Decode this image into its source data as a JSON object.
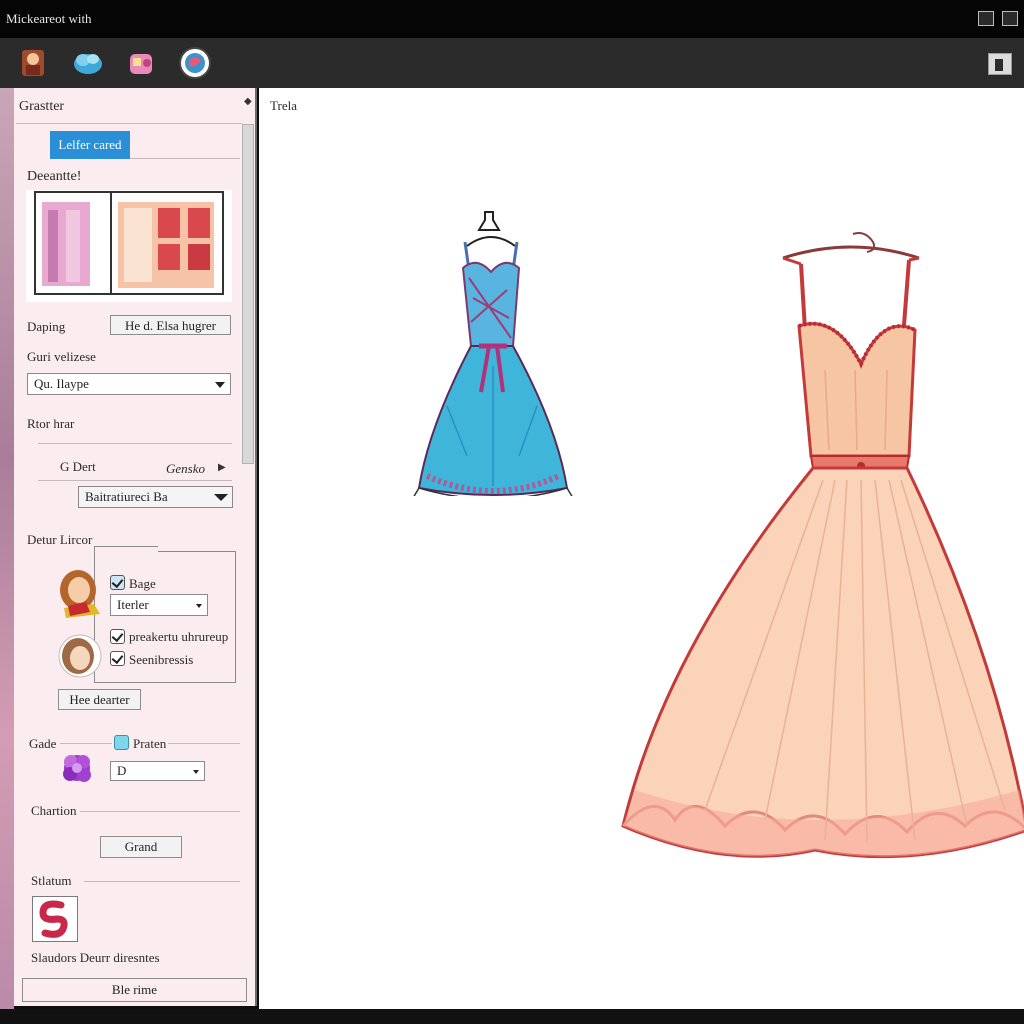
{
  "window": {
    "title": "Mickeareot with"
  },
  "toolbar": {
    "tools": [
      {
        "icon": "character-icon"
      },
      {
        "icon": "cloud-icon"
      },
      {
        "icon": "pig-icon"
      },
      {
        "icon": "globe-icon"
      }
    ],
    "right_icon": "flag-icon"
  },
  "sidebar": {
    "header": "Grastter",
    "tab_active": "Lelfer cared",
    "section_title": "Deeantte!",
    "draping": {
      "label": "Daping",
      "button": "He d. Elsa hugrer"
    },
    "gurl_size": {
      "label": "Guri velizese",
      "value": "Qu. Ilaype"
    },
    "rtor_hrar": {
      "label": "Rtor hrar"
    },
    "g_dert": {
      "label": "G Dert",
      "link": "Gensko"
    },
    "dropdown": {
      "value": "Baitratiureci Ba"
    },
    "detur": {
      "label": "Detur Lircor",
      "option_1": "Bage",
      "select_value": "Iterler",
      "option_2": "preakertu uhrureup",
      "option_3": "Seenibressis"
    },
    "hee_button": "Hee dearter",
    "grade": {
      "label": "Gade",
      "option": "Praten",
      "select_value": "D"
    },
    "chartion": {
      "label": "Chartion",
      "button": "Grand"
    },
    "status": {
      "label": "Stlatum",
      "caption": "Slaudors Deurr diresntes"
    },
    "footer_button": "Ble rime"
  },
  "canvas": {
    "label": "Trela"
  },
  "colors": {
    "sidebar_bg": "#fbecef",
    "accent": "#2a8fd6",
    "dress_blue": "#3fb5d9",
    "dress_peach": "#fbd3b8",
    "dress_outline": "#b63a3a"
  }
}
